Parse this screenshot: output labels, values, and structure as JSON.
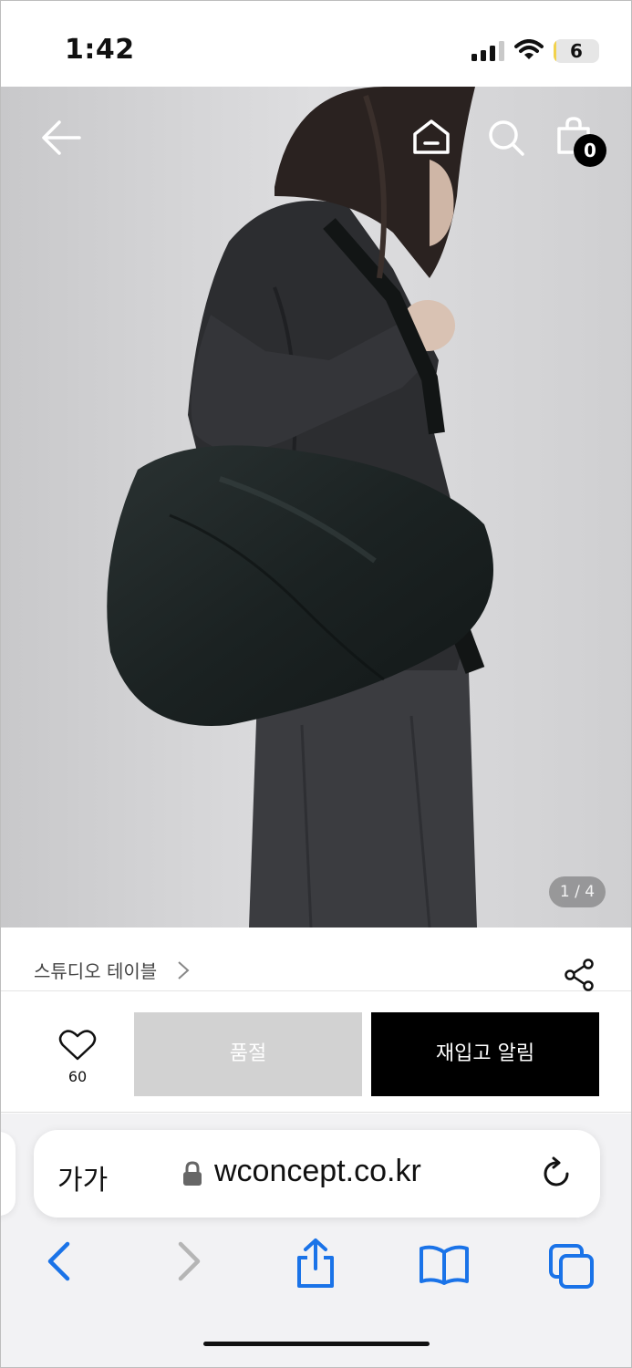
{
  "status_bar": {
    "time": "1:42",
    "battery_level": "6",
    "battery_fraction": 0.06,
    "icons": [
      "cellular-signal-icon",
      "wifi-icon",
      "battery-icon"
    ]
  },
  "header": {
    "icons": [
      "back-arrow-icon",
      "home-icon",
      "search-icon",
      "shopping-bag-icon"
    ],
    "cart_count": "0"
  },
  "gallery": {
    "counter": "1 / 4",
    "current": 1,
    "total": 4
  },
  "product": {
    "brand": "스튜디오 테이블"
  },
  "actions": {
    "wishlist_count": "60",
    "soldout_label": "품절",
    "restock_label": "재입고 알림"
  },
  "browser": {
    "text_size_label": "가가",
    "url": "wconcept.co.kr",
    "toolbar": [
      "back-icon",
      "forward-icon",
      "share-icon",
      "bookmarks-icon",
      "tabs-icon"
    ],
    "accent": "#1a73e8"
  }
}
